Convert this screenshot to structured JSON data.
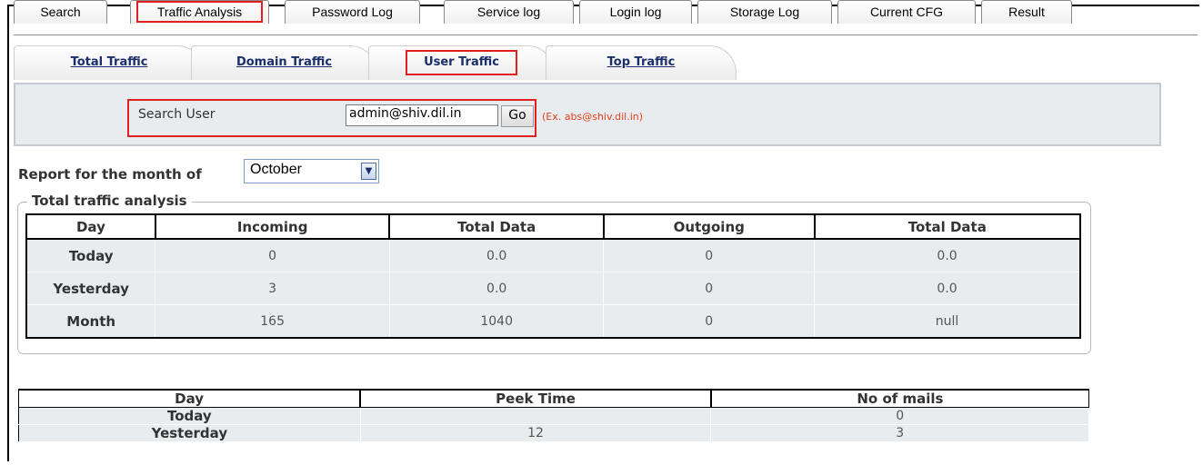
{
  "top_tabs": [
    "Search",
    "Traffic Analysis",
    "Password Log",
    "Service log",
    "Login log",
    "Storage Log",
    "Current CFG",
    "Result"
  ],
  "sub_tabs": [
    "Total Traffic",
    "Domain Traffic",
    "User Traffic",
    "Top Traffic"
  ],
  "search": {
    "label": "Search User",
    "value": "admin@shiv.dil.in",
    "go_label": "Go",
    "example": "(Ex. abs@shiv.dil.in)"
  },
  "report": {
    "label": "Report for the month of",
    "month": "October"
  },
  "traffic": {
    "legend": "Total traffic analysis",
    "headers": [
      "Day",
      "Incoming",
      "Total Data",
      "Outgoing",
      "Total Data"
    ],
    "rows": [
      [
        "Today",
        "0",
        "0.0",
        "0",
        "0.0"
      ],
      [
        "Yesterday",
        "3",
        "0.0",
        "0",
        "0.0"
      ],
      [
        "Month",
        "165",
        "1040",
        "0",
        "null"
      ]
    ]
  },
  "peak": {
    "headers": [
      "Day",
      "Peek Time",
      "No of mails"
    ],
    "rows": [
      [
        "Today",
        "",
        "0"
      ],
      [
        "Yesterday",
        "12",
        "3"
      ]
    ]
  },
  "colors": {
    "highlight": "#e02020",
    "link": "#1a2e6a",
    "example": "#e0401a",
    "cell_bg": "#e9ecef"
  }
}
